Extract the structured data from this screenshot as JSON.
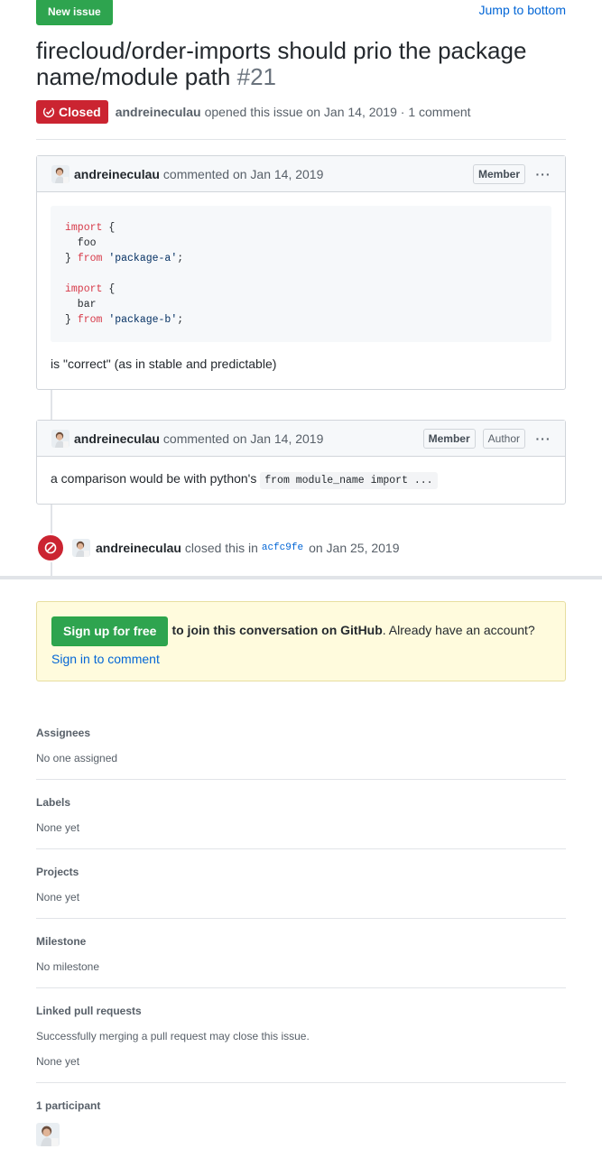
{
  "header": {
    "new_issue": "New issue",
    "jump": "Jump to bottom",
    "title": "firecloud/order-imports should prio the package name/module path",
    "number": "#21"
  },
  "meta": {
    "state": "Closed",
    "author": "andreineculau",
    "opened": "opened this issue on Jan 14, 2019 · 1 comment"
  },
  "comments": [
    {
      "author": "andreineculau",
      "when": "commented on Jan 14, 2019",
      "labels": [
        "Member"
      ],
      "code_lines": [
        [
          [
            "kw",
            "import"
          ],
          [
            "",
            "{"
          ]
        ],
        [
          [
            "",
            "  foo"
          ]
        ],
        [
          [
            "",
            "} "
          ],
          [
            "kw",
            "from"
          ],
          [
            "str",
            " 'package-a'"
          ],
          [
            "",
            ";"
          ]
        ],
        [
          [
            "",
            ""
          ]
        ],
        [
          [
            "kw",
            "import"
          ],
          [
            "",
            "{"
          ]
        ],
        [
          [
            "",
            "  bar"
          ]
        ],
        [
          [
            "",
            "} "
          ],
          [
            "kw",
            "from"
          ],
          [
            "str",
            " 'package-b'"
          ],
          [
            "",
            ";"
          ]
        ]
      ],
      "text": "is \"correct\" (as in stable and predictable)"
    },
    {
      "author": "andreineculau",
      "when": "commented on Jan 14, 2019",
      "labels": [
        "Member",
        "Author"
      ],
      "text": "a comparison would be with python's",
      "code": "from module_name import ..."
    }
  ],
  "event": {
    "author": "andreineculau",
    "text": "closed this in",
    "sha": "acfc9fe",
    "date": "on Jan 25, 2019"
  },
  "signup": {
    "button": "Sign up for free",
    "bold": "to join this conversation on GitHub",
    "rest": ". Already have an account? ",
    "link": "Sign in to comment"
  },
  "sidebar": {
    "assignees": {
      "heading": "Assignees",
      "value": "No one assigned"
    },
    "labels": {
      "heading": "Labels",
      "value": "None yet"
    },
    "projects": {
      "heading": "Projects",
      "value": "None yet"
    },
    "milestone": {
      "heading": "Milestone",
      "value": "No milestone"
    },
    "linked": {
      "heading": "Linked pull requests",
      "note": "Successfully merging a pull request may close this issue.",
      "value": "None yet"
    },
    "participants": {
      "heading": "1 participant"
    }
  },
  "colors": {
    "closed": "#cb2431",
    "green": "#2ea44f",
    "link": "#0366d6"
  }
}
